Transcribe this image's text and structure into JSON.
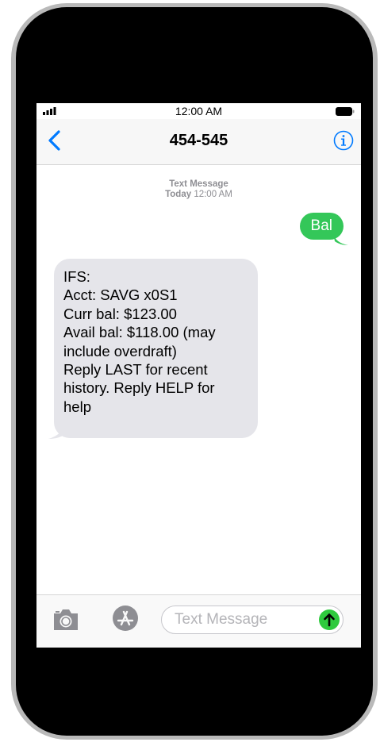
{
  "status_bar": {
    "time": "12:00 AM",
    "signal_icon": "signal-bars-icon",
    "battery_icon": "battery-icon"
  },
  "nav": {
    "title": "454-545",
    "back_icon": "chevron-left-icon",
    "info_icon": "info-icon"
  },
  "conversation": {
    "meta_label": "Text Message",
    "meta_day": "Today",
    "meta_time": "12:00 AM",
    "messages": [
      {
        "direction": "outgoing",
        "lines": [
          "Bal"
        ]
      },
      {
        "direction": "incoming",
        "lines": [
          "IFS:",
          "Acct: SAVG x0S1",
          "Curr bal:  $123.00",
          "Avail bal: $118.00 (may",
          "include overdraft)",
          "Reply LAST for recent",
          "history. Reply HELP for",
          "help"
        ]
      }
    ]
  },
  "input_bar": {
    "camera_icon": "camera-icon",
    "appstore_icon": "app-store-icon",
    "placeholder": "Text Message",
    "value": "",
    "send_icon": "send-arrow-up-icon"
  },
  "colors": {
    "outgoing_bubble": "#34c759",
    "incoming_bubble": "#e5e5ea",
    "accent": "#007aff",
    "phone_frame": "#b9b9b9"
  }
}
